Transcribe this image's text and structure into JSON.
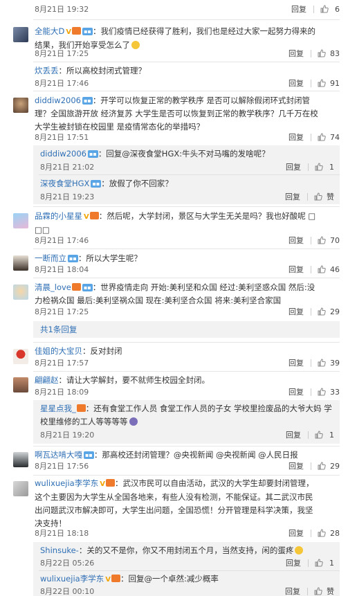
{
  "common": {
    "reply": "回复",
    "like_icon": "thumb-up-icon"
  },
  "c0": {
    "time": "8月21日 19:32",
    "likes": "6"
  },
  "c1": {
    "name": "全能大D",
    "text": "：我们疫情已经获得了胜利，我们也是经过大家一起努力得来的结果，我们开始享受怎么了",
    "time": "8月21日 17:25",
    "likes": "83"
  },
  "c2": {
    "name": "炊丢丢",
    "text": "：所以高校封闭式管理？",
    "time": "8月21日 17:46",
    "likes": "91"
  },
  "c3": {
    "name": "diddiw2006",
    "text": "：开学可以恢复正常的教学秩序 是否可以解除假闭环式封闭管理？全国旅游开放 经济复苏 大学生是否可以恢复到正常的教学秩序？几千万在校大学生被封锁在校园里 是疫情常态化的举措吗？",
    "time": "8月21日 17:51",
    "likes": "74",
    "r1": {
      "name": "diddiw2006",
      "text": "：回复@深夜食堂HGX:牛头不对马嘴的发啥呢？",
      "time": "8月21日 21:02",
      "likes": "1"
    },
    "r2": {
      "name": "深夜食堂HGX",
      "text": "：放假了你不回家？",
      "time": "8月21日 19:23",
      "likes": "赞"
    }
  },
  "c4": {
    "name": "品霖的小星星",
    "text": "：然后呢，大学封闭，景区与大学生无关是吗？我也好酸呢 □□□",
    "time": "8月21日 17:46",
    "likes": "70"
  },
  "c5": {
    "name": "一断而立",
    "text": "：所以大学生呢？",
    "time": "8月21日 18:04",
    "likes": "46"
  },
  "c6": {
    "name": "清晨_love",
    "text": "：世界疫情走向 开始:美利坚和众国 经过:美利坚惑众国 然后:没力检祸众国 最后:美利坚祸众国 现在:美利坚合众国 将来:美利坚合家国",
    "time": "8月21日 17:25",
    "likes": "29",
    "more": "共1条回复"
  },
  "c7": {
    "name": "佳姐的大宝贝",
    "text": "：反对封闭",
    "time": "8月21日 17:57",
    "likes": "39"
  },
  "c8": {
    "name": "翩翩赵",
    "text": "：请让大学解封，要不就师生校园全封闭。",
    "time": "8月21日 18:09",
    "likes": "33",
    "r1": {
      "name": "星星点我_",
      "text": "：还有食堂工作人员 食堂工作人员的子女 学校里捡废品的大爷大妈 学校里维修的工人等等等等",
      "time": "8月21日 19:20",
      "likes": "1"
    }
  },
  "c9": {
    "name": "啊瓦达啃大嘎",
    "text": "：那高校还封闭管理？@央视新闻 @央视新闻 @人民日报",
    "time": "8月21日 17:56",
    "likes": "29"
  },
  "c10": {
    "name": "wulixuejia李学东",
    "text": "：武汉市民可以自由活动，武汉的大学生却要封闭管理，这个主要因为大学生从全国各地来，有些人没有检测，不能保证。其二武汉市民出问题武汉市解决即可，大学生出问题，全国恐慌！分开管理是科学决策，我坚决支持！",
    "time": "8月21日 18:18",
    "likes": "28",
    "r1": {
      "name": "Shinsuke-",
      "text": "：关的又不是你，你又不用封闭五个月，当然支持，闲的蛋疼",
      "time": "8月22日 05:26",
      "likes": "1"
    },
    "r2": {
      "name": "wulixuejia李学东",
      "text": "：回复@一个卓然:减少概率",
      "time": "8月22日 00:10",
      "likes": "赞"
    }
  }
}
